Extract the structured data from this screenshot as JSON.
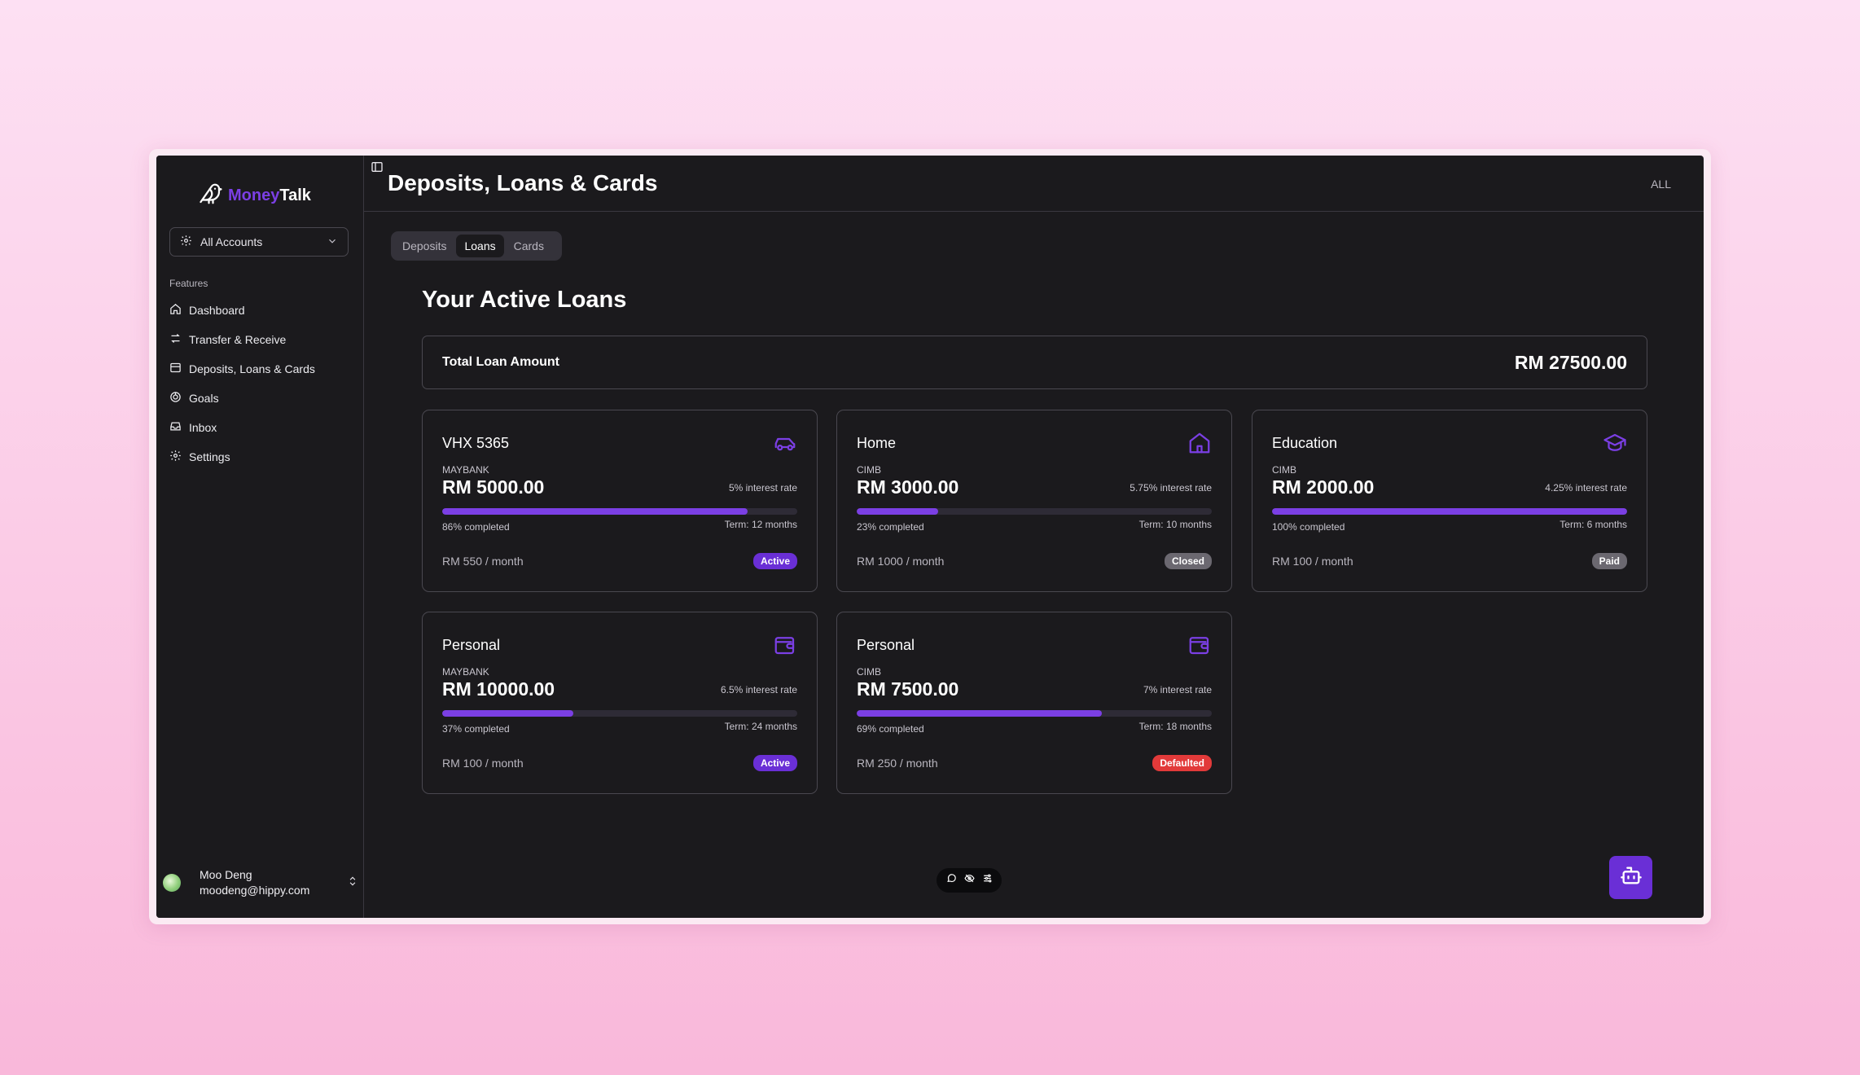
{
  "app": {
    "brand_part1": "Money",
    "brand_part2": "Talk",
    "accent_color": "#7b3fe4"
  },
  "sidebar": {
    "account_selector": "All Accounts",
    "features_label": "Features",
    "items": [
      {
        "label": "Dashboard",
        "icon": "home-icon"
      },
      {
        "label": "Transfer & Receive",
        "icon": "arrows-icon"
      },
      {
        "label": "Deposits, Loans & Cards",
        "icon": "card-icon"
      },
      {
        "label": "Goals",
        "icon": "target-icon"
      },
      {
        "label": "Inbox",
        "icon": "inbox-icon"
      },
      {
        "label": "Settings",
        "icon": "gear-icon"
      }
    ],
    "user": {
      "name": "Moo Deng",
      "email": "moodeng@hippy.com"
    }
  },
  "header": {
    "title": "Deposits, Loans & Cards",
    "filter": "ALL"
  },
  "tabs": [
    {
      "label": "Deposits",
      "active": false
    },
    {
      "label": "Loans",
      "active": true
    },
    {
      "label": "Cards",
      "active": false
    }
  ],
  "section_title": "Your Active Loans",
  "total": {
    "label": "Total Loan Amount",
    "value": "RM 27500.00"
  },
  "loans": [
    {
      "title": "VHX 5365",
      "icon": "car-icon",
      "bank": "MAYBANK",
      "amount": "RM 5000.00",
      "rate": "5% interest rate",
      "progress": 0.86,
      "completed": "86% completed",
      "term": "Term: 12 months",
      "monthly": "RM 550 / month",
      "status": "Active"
    },
    {
      "title": "Home",
      "icon": "house-icon",
      "bank": "CIMB",
      "amount": "RM 3000.00",
      "rate": "5.75% interest rate",
      "progress": 0.23,
      "completed": "23% completed",
      "term": "Term: 10 months",
      "monthly": "RM 1000 / month",
      "status": "Closed"
    },
    {
      "title": "Education",
      "icon": "graduation-cap-icon",
      "bank": "CIMB",
      "amount": "RM 2000.00",
      "rate": "4.25% interest rate",
      "progress": 1.0,
      "completed": "100% completed",
      "term": "Term: 6 months",
      "monthly": "RM 100 / month",
      "status": "Paid"
    },
    {
      "title": "Personal",
      "icon": "wallet-icon",
      "bank": "MAYBANK",
      "amount": "RM 10000.00",
      "rate": "6.5% interest rate",
      "progress": 0.37,
      "completed": "37% completed",
      "term": "Term: 24 months",
      "monthly": "RM 100 / month",
      "status": "Active"
    },
    {
      "title": "Personal",
      "icon": "wallet-icon",
      "bank": "CIMB",
      "amount": "RM 7500.00",
      "rate": "7% interest rate",
      "progress": 0.69,
      "completed": "69% completed",
      "term": "Term: 18 months",
      "monthly": "RM 250 / month",
      "status": "Defaulted"
    }
  ]
}
